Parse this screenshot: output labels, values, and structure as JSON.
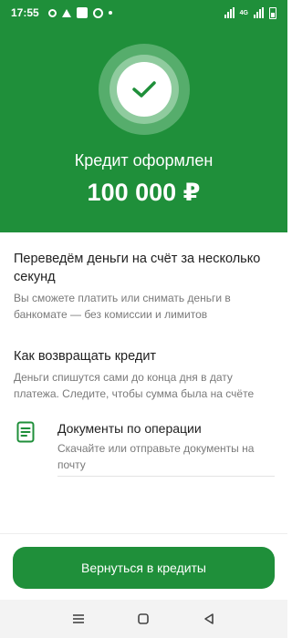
{
  "status_bar": {
    "time": "17:55",
    "network_label": "4G"
  },
  "hero": {
    "title": "Кредит оформлен",
    "amount": "100 000 ₽"
  },
  "transfer": {
    "title": "Переведём деньги на счёт за несколько секунд",
    "text": "Вы сможете платить или снимать деньги в банкомате — без комиссии и лимитов"
  },
  "repay": {
    "title": "Как возвращать кредит",
    "text": "Деньги спишутся сами до конца дня в дату платежа. Следите, чтобы сумма была на счёте"
  },
  "documents": {
    "icon": "document-icon",
    "title": "Документы по операции",
    "subtitle": "Скачайте или отправьте документы на почту"
  },
  "actions": {
    "return_label": "Вернуться в кредиты"
  },
  "colors": {
    "brand": "#1f8f3a",
    "ring_outer": "#56ad6c",
    "ring_mid": "#8fcb9e"
  }
}
